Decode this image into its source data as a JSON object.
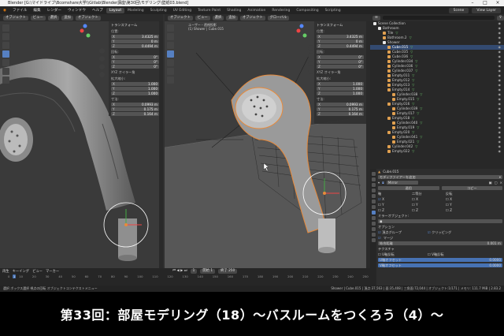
{
  "title_bar": {
    "text": "Blender [G:\\マイドライブ\\Bcomshare大学\\\\Gitlab\\Blender講座\\第30回\\モデリング\\壁紙03.blend]"
  },
  "menu": [
    "ファイル",
    "編集",
    "レンダー",
    "ウィンドウ",
    "ヘルプ"
  ],
  "workspace_tabs": [
    "Layout",
    "Modeling",
    "Sculpting",
    "UV Editing",
    "Texture Paint",
    "Shading",
    "Animation",
    "Rendering",
    "Compositing",
    "Scripting"
  ],
  "active_tab": "Layout",
  "scene": {
    "label": "Scene",
    "view_layer": "View Layer"
  },
  "viewport_left": {
    "mode": "オブジェクト",
    "header_buttons": [
      "ビュー",
      "選択",
      "追加",
      "オブジェクト"
    ],
    "transform_panel": {
      "title": "トランスフォーム",
      "location_label": "位置:",
      "location": [
        [
          "X",
          "3.4325 m"
        ],
        [
          "Y",
          "0 m"
        ],
        [
          "Z",
          "0.4494 m"
        ]
      ],
      "rotation_label": "回転:",
      "rotation": [
        [
          "X",
          "0°"
        ],
        [
          "Y",
          "0°"
        ],
        [
          "Z",
          "0°"
        ]
      ],
      "rot_mode": "XYZ オイラー角",
      "scale_label": "拡大縮小:",
      "scale": [
        [
          "X",
          "1.000"
        ],
        [
          "Y",
          "1.000"
        ],
        [
          "Z",
          "1.000"
        ]
      ],
      "dims_label": "寸法:",
      "dims": [
        [
          "X",
          "0.0993 m"
        ],
        [
          "Y",
          "0.175 m"
        ],
        [
          "Z",
          "0.164 m"
        ]
      ]
    }
  },
  "viewport_right": {
    "mode": "オブジェクト",
    "header_buttons": [
      "ビュー",
      "選択",
      "追加",
      "オブジェクト"
    ],
    "view_name": "ユーザー・透視投影",
    "object_info": "(1) Shower | Cube.015",
    "orientation": "グローバル",
    "transform_panel": {
      "title": "トランスフォーム",
      "location_label": "位置:",
      "location": [
        [
          "X",
          "3.4325 m"
        ],
        [
          "Y",
          "0 m"
        ],
        [
          "Z",
          "0.4494 m"
        ]
      ],
      "rotation_label": "回転:",
      "rotation": [
        [
          "X",
          "0°"
        ],
        [
          "Y",
          "0°"
        ],
        [
          "Z",
          "0°"
        ]
      ],
      "rot_mode": "XYZ オイラー角",
      "scale_label": "拡大縮小:",
      "scale": [
        [
          "X",
          "1.000"
        ],
        [
          "Y",
          "1.000"
        ],
        [
          "Z",
          "1.000"
        ]
      ],
      "dims_label": "寸法:",
      "dims": [
        [
          "X",
          "0.0993 m"
        ],
        [
          "Y",
          "0.175 m"
        ],
        [
          "Z",
          "0.164 m"
        ]
      ]
    }
  },
  "outliner": {
    "rows": [
      {
        "name": "Scene Collection",
        "kind": "col",
        "sel": false,
        "indent": 0
      },
      {
        "name": "Bathroom",
        "kind": "col",
        "sel": false,
        "indent": 1
      },
      {
        "name": "Tile",
        "kind": "mesh",
        "sel": false,
        "indent": 2
      },
      {
        "name": "Bathroom.2",
        "kind": "mesh",
        "sel": false,
        "indent": 2
      },
      {
        "name": "Shower",
        "kind": "col",
        "sel": false,
        "indent": 2
      },
      {
        "name": "Cube.015",
        "kind": "mesh",
        "sel": true,
        "indent": 3
      },
      {
        "name": "Cube.035",
        "kind": "mesh",
        "sel": false,
        "indent": 3
      },
      {
        "name": "Cube.036",
        "kind": "mesh",
        "sel": false,
        "indent": 3
      },
      {
        "name": "Cylinder.034",
        "kind": "mesh",
        "sel": false,
        "indent": 3
      },
      {
        "name": "Cylinder.036",
        "kind": "mesh",
        "sel": false,
        "indent": 3
      },
      {
        "name": "Cylinder.037",
        "kind": "mesh",
        "sel": false,
        "indent": 3
      },
      {
        "name": "Empty.011",
        "kind": "mesh",
        "sel": false,
        "indent": 3
      },
      {
        "name": "Empty.012",
        "kind": "mesh",
        "sel": false,
        "indent": 3
      },
      {
        "name": "Empty.013",
        "kind": "mesh",
        "sel": false,
        "indent": 3
      },
      {
        "name": "Empty.014",
        "kind": "mesh",
        "sel": false,
        "indent": 3
      },
      {
        "name": "Cylinder.038",
        "kind": "mesh",
        "sel": false,
        "indent": 4
      },
      {
        "name": "Empty.015",
        "kind": "mesh",
        "sel": false,
        "indent": 4
      },
      {
        "name": "Empty.016",
        "kind": "mesh",
        "sel": false,
        "indent": 3
      },
      {
        "name": "Cylinder.039",
        "kind": "mesh",
        "sel": false,
        "indent": 4
      },
      {
        "name": "Empty.017",
        "kind": "mesh",
        "sel": false,
        "indent": 4
      },
      {
        "name": "Empty.018",
        "kind": "mesh",
        "sel": false,
        "indent": 3
      },
      {
        "name": "Cylinder.040",
        "kind": "mesh",
        "sel": false,
        "indent": 4
      },
      {
        "name": "Empty.019",
        "kind": "mesh",
        "sel": false,
        "indent": 4
      },
      {
        "name": "Empty.020",
        "kind": "mesh",
        "sel": false,
        "indent": 3
      },
      {
        "name": "Cylinder.041",
        "kind": "mesh",
        "sel": false,
        "indent": 4
      },
      {
        "name": "Empty.021",
        "kind": "mesh",
        "sel": false,
        "indent": 4
      },
      {
        "name": "Cylinder.042",
        "kind": "mesh",
        "sel": false,
        "indent": 3
      },
      {
        "name": "Empty.022",
        "kind": "mesh",
        "sel": false,
        "indent": 3
      }
    ]
  },
  "properties": {
    "object_name": "Cube.015",
    "section": "モディファイアーを追加",
    "modifier": "Mirror",
    "apply": "適用",
    "copy": "コピー",
    "axis_label": "軸",
    "bisect_label": "二等分",
    "flip_label": "反転",
    "axes": [
      "X",
      "Y",
      "Z"
    ],
    "mirror_object_label": "ミラーオブジェクト:",
    "options_label": "オプション",
    "vertex_groups": "頂点グループ",
    "clipping": "クリッピング",
    "merge": "マージ",
    "merge_dist_label": "結合距離",
    "merge_dist": "0.001 m",
    "textures_label": "テクスチャ",
    "u_mirror": "U軸反転",
    "v_mirror": "V軸反転",
    "u_offset_label": "U軸オフセット",
    "u_offset": "0.0000",
    "v_offset_label": "V軸オフセット",
    "v_offset": "0.0000"
  },
  "timeline": {
    "menus": [
      "再生",
      "キーイング",
      "ビュー",
      "マーカー"
    ],
    "current_frame": "1",
    "start_label": "開始",
    "start": "1",
    "end_label": "終了",
    "end": "250",
    "ticks": [
      "0",
      "10",
      "20",
      "30",
      "40",
      "50",
      "60",
      "70",
      "80",
      "90",
      "100",
      "110",
      "120",
      "130",
      "140",
      "150",
      "160",
      "170",
      "180",
      "190",
      "200",
      "210",
      "220",
      "230",
      "240",
      "250"
    ]
  },
  "status_bar": {
    "left": "選択    ボックス選択    視点の回転    オブジェクトコンテクストメニュー",
    "right": "Shower | Cube.015 | 頂点:37,563 | 面:35,408 | 三角面:72,044 | オブジェクト:1/171 | メモリ: 111.7 MiB | 2.83.2"
  },
  "caption": "第33回：部屋モデリング（18）〜バスルームをつくろう（4）〜"
}
